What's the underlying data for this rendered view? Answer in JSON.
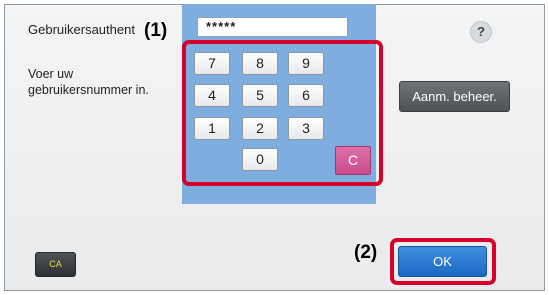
{
  "screen": {
    "title_label": "Gebruikersauthent",
    "instruction": "Voer uw gebruikersnummer in.",
    "password_value": "*****"
  },
  "keypad": {
    "keys": [
      "7",
      "8",
      "9",
      "4",
      "5",
      "6",
      "1",
      "2",
      "3",
      "0"
    ],
    "clear_label": "C"
  },
  "buttons": {
    "help_label": "?",
    "manage_label": "Aanm. beheer.",
    "ca_label": "CA",
    "ok_label": "OK"
  },
  "callouts": {
    "keypad": "(1)",
    "ok": "(2)"
  },
  "colors": {
    "keypad_background": "#7eaee0",
    "highlight_frame": "#d6002a",
    "clear_key": "#c94d8e",
    "ok_button": "#1c68c4",
    "manage_button": "#5b6064"
  },
  "icons": {
    "help": "question-mark-icon"
  }
}
